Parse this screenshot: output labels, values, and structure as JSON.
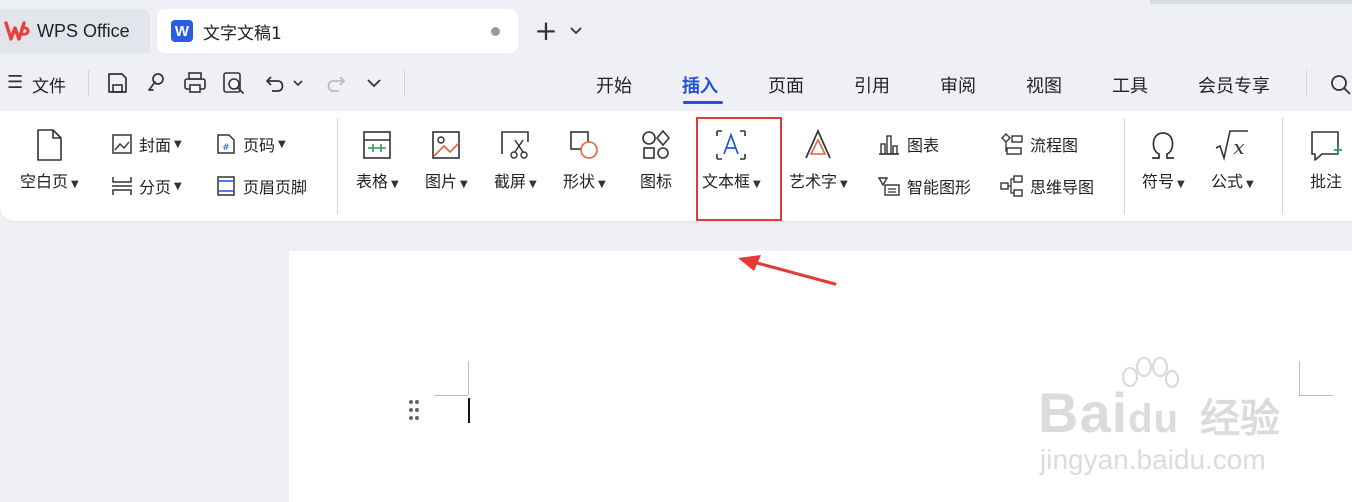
{
  "tabbar": {
    "app_title": "WPS Office",
    "doc_badge": "W",
    "doc_title": "文字文稿1",
    "new_tab": "+"
  },
  "menu": {
    "menu_glyph": "☰",
    "file": "文件",
    "tabs": [
      "开始",
      "插入",
      "页面",
      "引用",
      "审阅",
      "视图",
      "工具",
      "会员专享"
    ],
    "active_tab": "插入"
  },
  "ribbon": {
    "blank_page": "空白页",
    "cover": "封面",
    "page_break": "分页",
    "page_number": "页码",
    "header_footer": "页眉页脚",
    "table": "表格",
    "picture": "图片",
    "screenshot": "截屏",
    "shape": "形状",
    "icon": "图标",
    "textbox": "文本框",
    "wordart": "艺术字",
    "chart": "图表",
    "smartart": "智能图形",
    "flowchart": "流程图",
    "mindmap": "思维导图",
    "symbol": "符号",
    "formula": "公式",
    "comment": "批注"
  },
  "watermark": {
    "brand_en": "Bai",
    "brand_du": "du",
    "brand_cn": "经验",
    "url": "jingyan.baidu.com"
  },
  "colors": {
    "accent": "#2453d6",
    "highlight": "#e53935",
    "wps_red": "#e8413c",
    "word_blue": "#2b5ce6"
  },
  "icons": [
    "wps-logo-icon",
    "menu-icon",
    "save-icon",
    "link-icon",
    "print-icon",
    "print-preview-icon",
    "undo-icon",
    "redo-icon",
    "more-icon",
    "search-icon"
  ]
}
